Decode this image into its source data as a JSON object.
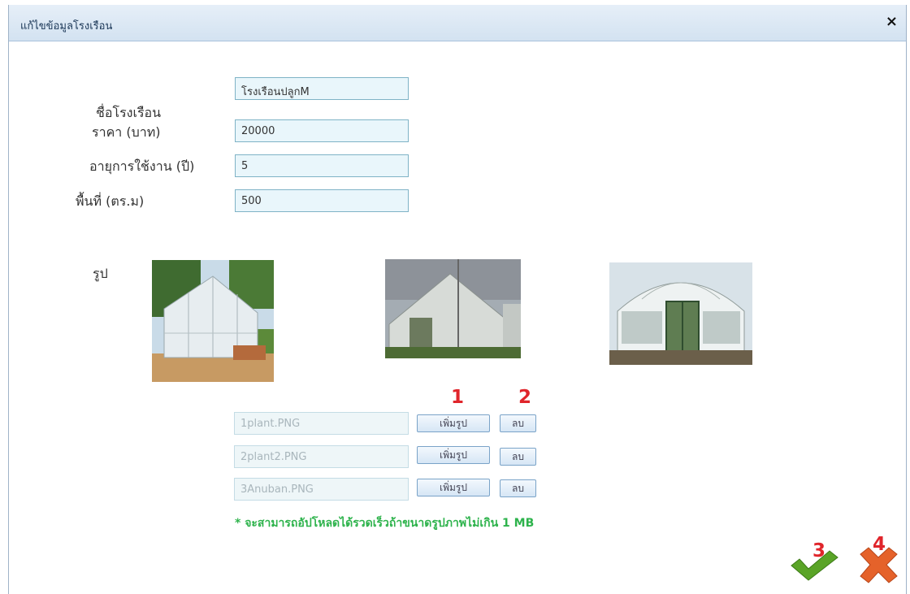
{
  "window": {
    "title": "แก้ไขข้อมูลโรงเรือน",
    "close_glyph": "×"
  },
  "form": {
    "name_label": "ชื่อโรงเรือน",
    "name_value": "โรงเรือนปลูกM",
    "price_label": "ราคา (บาท)",
    "price_value": "20000",
    "lifetime_label": "อายุการใช้งาน (ปี)",
    "lifetime_value": "5",
    "area_label": "พื้นที่ (ตร.ม)",
    "area_value": "500"
  },
  "images": {
    "label": "รูป",
    "files": [
      {
        "filename": "1plant.PNG",
        "add_label": "เพิ่มรูป",
        "delete_label": "ลบ"
      },
      {
        "filename": "2plant2.PNG",
        "add_label": "เพิ่มรูป",
        "delete_label": "ลบ"
      },
      {
        "filename": "3Anuban.PNG",
        "add_label": "เพิ่มรูป",
        "delete_label": "ลบ"
      }
    ]
  },
  "note": "* จะสามารถอัปโหลดได้รวดเร็วถ้าขนาดรูปภาพไม่เกิน 1 MB",
  "markers": {
    "add": "1",
    "delete": "2",
    "confirm": "3",
    "cancel": "4"
  },
  "actions": {
    "confirm_icon": "checkmark-icon",
    "cancel_icon": "x-icon"
  },
  "colors": {
    "marker": "#e0252b",
    "note": "#2eb34c",
    "confirm": "#5aa427",
    "cancel": "#e5622a"
  }
}
